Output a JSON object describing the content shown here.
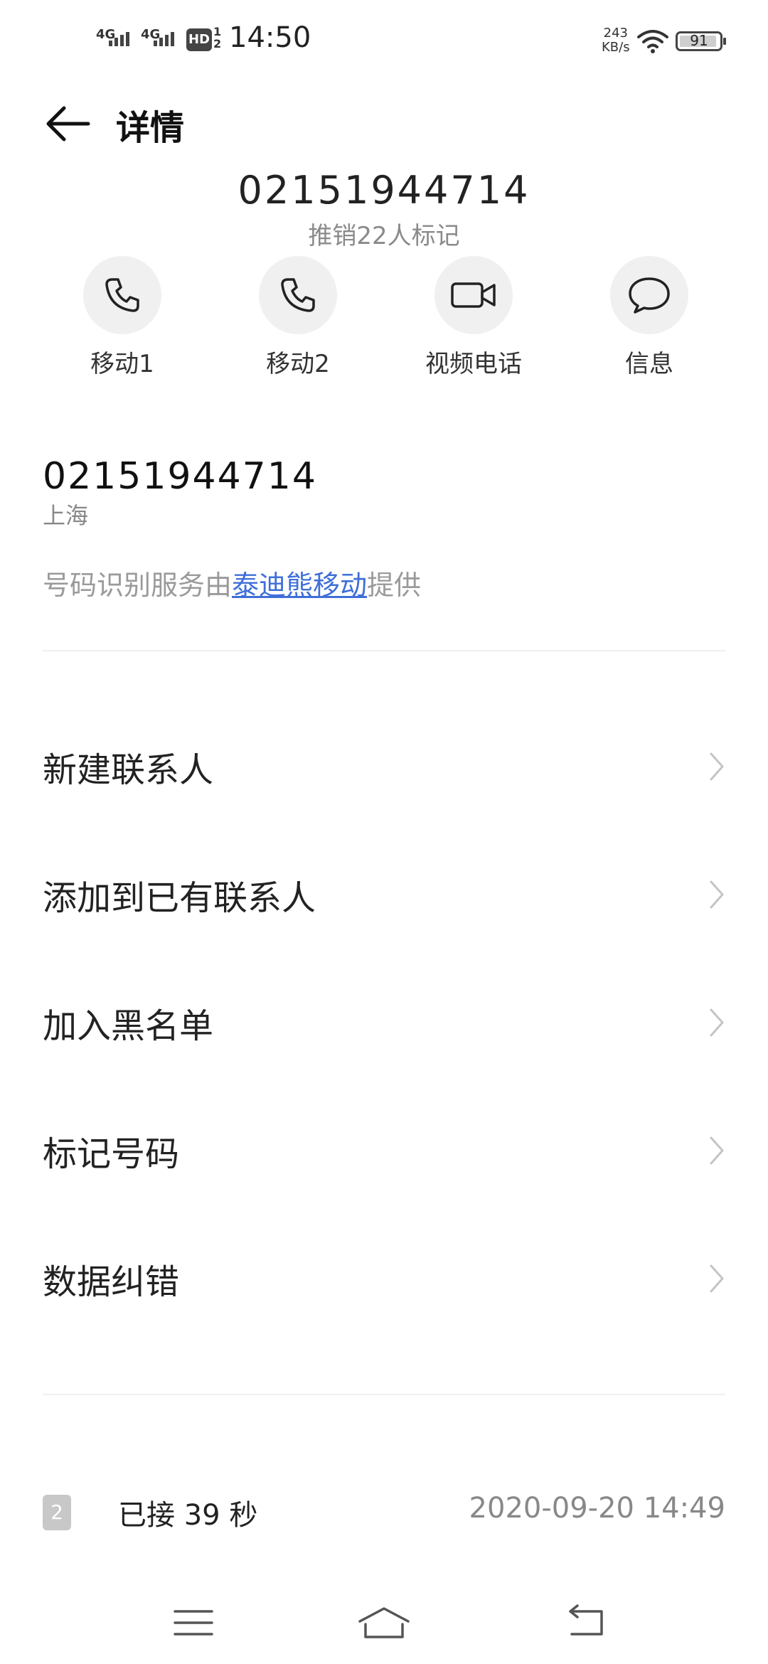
{
  "status_bar": {
    "sim1_network": "4G",
    "sim2_network": "4G",
    "hd_label": "HD",
    "hd_slots": "1 2",
    "time": "14:50",
    "net_speed_value": "243",
    "net_speed_unit": "KB/s",
    "battery_level": "91"
  },
  "header": {
    "back_icon": "arrow-left-icon",
    "title": "详情"
  },
  "hero": {
    "number": "02151944714",
    "tag": "推销22人标记"
  },
  "actions": [
    {
      "label": "移动1",
      "icon": "phone-icon"
    },
    {
      "label": "移动2",
      "icon": "phone-icon"
    },
    {
      "label": "视频电话",
      "icon": "video-camera-icon"
    },
    {
      "label": "信息",
      "icon": "message-bubble-icon"
    }
  ],
  "detail": {
    "number": "02151944714",
    "location": "上海",
    "provider_prefix": "号码识别服务由",
    "provider_link": "泰迪熊移动",
    "provider_suffix": "提供"
  },
  "menu": [
    {
      "label": "新建联系人"
    },
    {
      "label": "添加到已有联系人"
    },
    {
      "label": "加入黑名单"
    },
    {
      "label": "标记号码"
    },
    {
      "label": "数据纠错"
    }
  ],
  "call_log": {
    "sim_badge": "2",
    "status": "已接 39 秒",
    "datetime": "2020-09-20  14:49"
  },
  "navbar": {
    "menu_icon": "menu-icon",
    "home_icon": "home-icon",
    "back_icon": "back-icon"
  },
  "colors": {
    "link": "#3f6fd8",
    "secondary_text": "#8a8a8a",
    "circle_bg": "#f0f0f0"
  }
}
